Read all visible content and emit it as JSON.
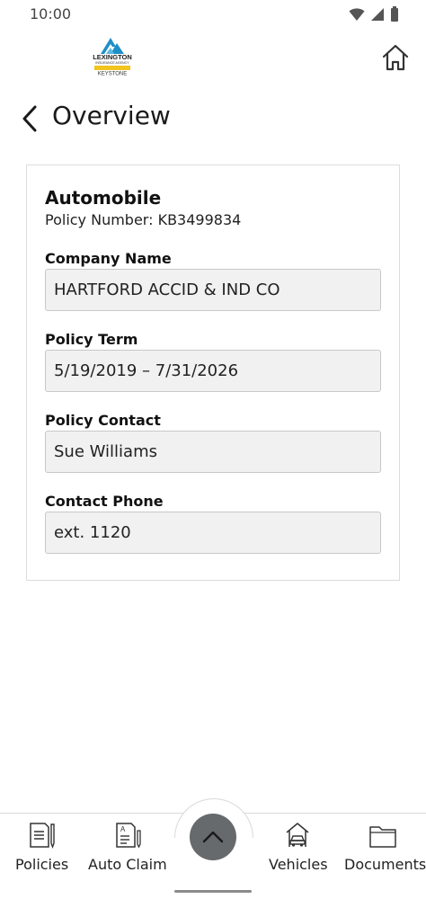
{
  "status_bar": {
    "time": "10:00"
  },
  "header": {
    "logo_text_top": "LEXINGTON",
    "logo_text_mid": "INSURANCE AGENCY",
    "logo_text_bottom": "KEYSTONE",
    "brand_color": "#1e8fc6",
    "accent_color": "#f2c41d"
  },
  "page": {
    "title": "Overview"
  },
  "policy": {
    "type": "Automobile",
    "number_line": "Policy Number: KB3499834",
    "fields": [
      {
        "label": "Company Name",
        "value": "HARTFORD ACCID & IND CO"
      },
      {
        "label": "Policy Term",
        "value": "5/19/2019 – 7/31/2026"
      },
      {
        "label": "Policy Contact",
        "value": "Sue Williams"
      },
      {
        "label": "Contact Phone",
        "value": "ext. 1120"
      }
    ]
  },
  "bottom_nav": {
    "items": [
      {
        "label": "Policies",
        "icon": "policies-icon"
      },
      {
        "label": "Auto Claim",
        "icon": "auto-claim-icon"
      },
      {
        "label": "Vehicles",
        "icon": "vehicle-icon"
      },
      {
        "label": "Documents",
        "icon": "folder-icon"
      }
    ],
    "center_button_icon": "chevron-up-icon"
  }
}
